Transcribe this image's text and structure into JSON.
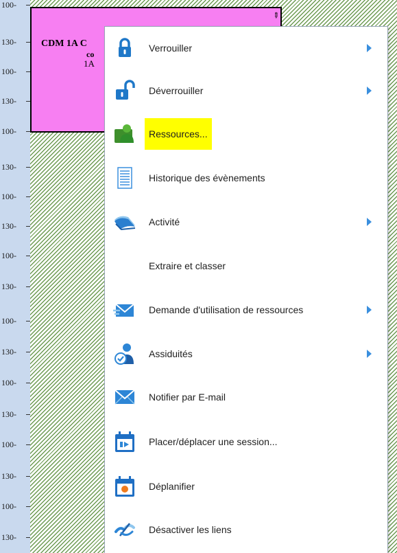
{
  "ruler": {
    "ticks": [
      "100-",
      "130-",
      "100-",
      "130-",
      "100-",
      "130-",
      "100-",
      "130-",
      "100-",
      "130-",
      "100-",
      "130-",
      "100-",
      "130-",
      "100-",
      "130-",
      "100-",
      "130-"
    ]
  },
  "event": {
    "title": "CDM 1A C",
    "line2": "co",
    "line3": "1A",
    "corner_glyph": "✎"
  },
  "menu": {
    "items": [
      {
        "label": "Verrouiller",
        "icon": "lock-closed-icon",
        "submenu": true,
        "highlighted": false
      },
      {
        "label": "Déverrouiller",
        "icon": "lock-open-icon",
        "submenu": true,
        "highlighted": false
      },
      {
        "label": "Ressources...",
        "icon": "resources-person-icon",
        "submenu": false,
        "highlighted": true
      },
      {
        "label": "Historique des évènements",
        "icon": "document-history-icon",
        "submenu": false,
        "highlighted": false
      },
      {
        "label": "Activité",
        "icon": "activity-book-icon",
        "submenu": true,
        "highlighted": false
      },
      {
        "label": "Extraire et classer",
        "icon": "",
        "submenu": false,
        "highlighted": false
      },
      {
        "label": "Demande d'utilisation de ressources",
        "icon": "envelope-request-icon",
        "submenu": true,
        "highlighted": false
      },
      {
        "label": "Assiduités",
        "icon": "attendance-person-check-icon",
        "submenu": true,
        "highlighted": false
      },
      {
        "label": "Notifier par E-mail",
        "icon": "email-envelope-icon",
        "submenu": false,
        "highlighted": false
      },
      {
        "label": "Placer/déplacer une session...",
        "icon": "calendar-move-icon",
        "submenu": false,
        "highlighted": false
      },
      {
        "label": "Déplanifier",
        "icon": "calendar-unschedule-icon",
        "submenu": false,
        "highlighted": false
      },
      {
        "label": "Désactiver les liens",
        "icon": "unlink-icon",
        "submenu": false,
        "highlighted": false
      }
    ]
  },
  "colors": {
    "highlight": "#ffff00",
    "event_fill": "#f77ff2",
    "hatch": "#6c9a52",
    "ruler": "#c9d9ee",
    "submenu_arrow": "#3a8fde"
  }
}
